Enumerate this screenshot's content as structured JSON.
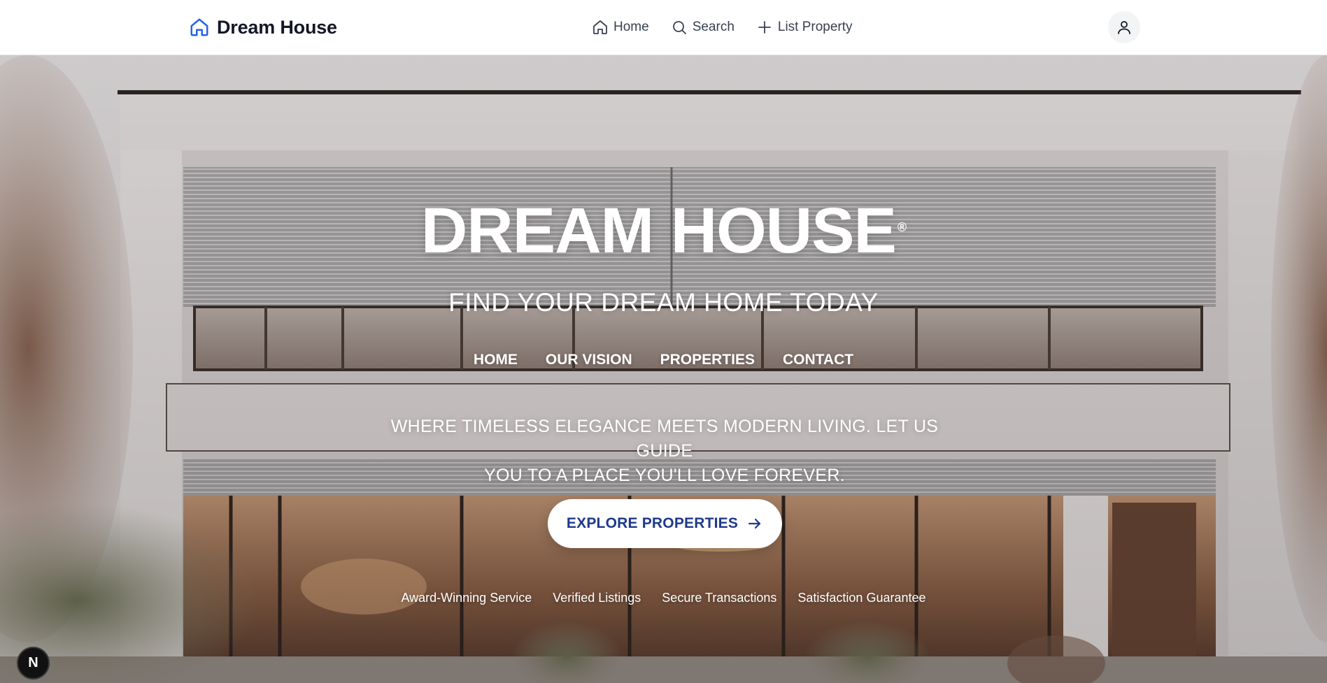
{
  "header": {
    "brand_name": "Dream House",
    "brand_icon": "home-icon",
    "nav": [
      {
        "label": "Home",
        "icon": "home-icon"
      },
      {
        "label": "Search",
        "icon": "search-icon"
      },
      {
        "label": "List Property",
        "icon": "plus-icon"
      }
    ],
    "account_icon": "user-icon"
  },
  "hero": {
    "title": "DREAM HOUSE",
    "trademark": "®",
    "subtitle": "FIND YOUR DREAM HOME TODAY",
    "menu": [
      "HOME",
      "OUR VISION",
      "PROPERTIES",
      "CONTACT"
    ],
    "tagline_line1": "WHERE TIMELESS ELEGANCE MEETS MODERN LIVING. LET US GUIDE",
    "tagline_line2": "YOU TO A PLACE YOU'LL LOVE FOREVER.",
    "cta": {
      "label": "EXPLORE PROPERTIES",
      "icon": "arrow-right-icon"
    },
    "features": [
      "Award-Winning Service",
      "Verified Listings",
      "Secure Transactions",
      "Satisfaction Guarantee"
    ]
  },
  "dev_badge": {
    "label": "N"
  },
  "colors": {
    "brand_icon": "#2563eb",
    "cta_text": "#1e3a8a",
    "nav_text": "#374151",
    "brand_text": "#111827"
  }
}
